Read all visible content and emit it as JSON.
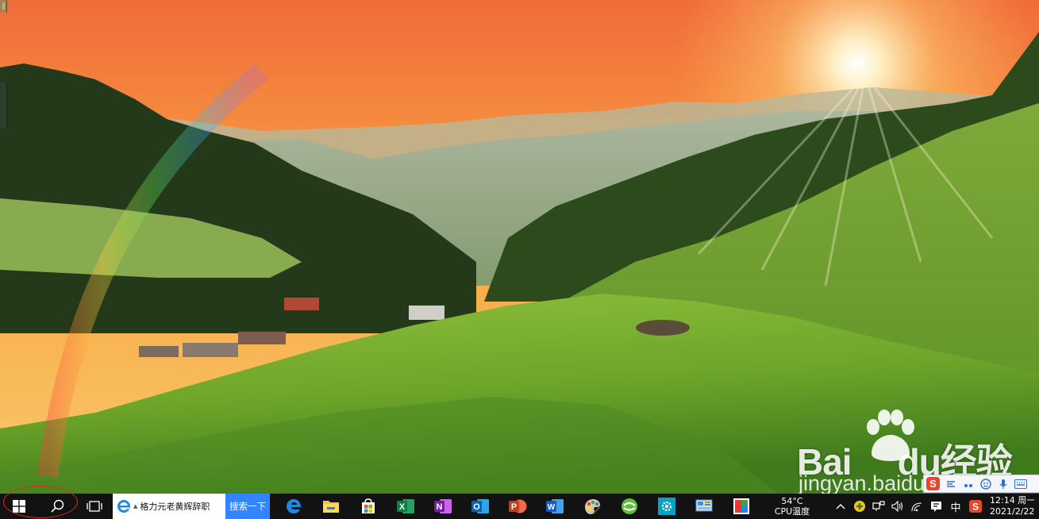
{
  "watermark": {
    "brand_latin": "Bai",
    "brand_latin_2": "du",
    "brand_cn": "经验",
    "url": "jingyan.baidu.com"
  },
  "ime_toolbar": {
    "logo": "S",
    "items": [
      "ime-mode-icon",
      "punctuation-icon",
      "emoji-icon",
      "microphone-icon",
      "keyboard-icon"
    ]
  },
  "taskbar": {
    "baidu_search": {
      "query": "格力元老黄辉辞职",
      "submit_label": "搜索一下"
    },
    "pinned_apps": [
      {
        "name": "edge-icon"
      },
      {
        "name": "file-explorer-icon"
      },
      {
        "name": "store-icon"
      },
      {
        "name": "excel-icon",
        "letter": "X"
      },
      {
        "name": "onenote-icon",
        "letter": "N"
      },
      {
        "name": "outlook-icon",
        "letter": "O"
      },
      {
        "name": "powerpoint-icon",
        "letter": "P"
      },
      {
        "name": "word-icon",
        "letter": "W"
      },
      {
        "name": "paint-icon"
      },
      {
        "name": "browser-360-icon"
      },
      {
        "name": "settings-icon"
      },
      {
        "name": "control-panel-icon"
      },
      {
        "name": "photos-icon"
      }
    ],
    "weather": {
      "temp": "54°C",
      "label": "CPU温度"
    },
    "tray": {
      "ime_lang": "中",
      "clock_time": "12:14 周一",
      "clock_date": "2021/2/22"
    }
  },
  "colors": {
    "taskbar_bg": "#121212",
    "baidu_blue": "#3385ff",
    "highlight_ellipse": "#e0281e"
  }
}
